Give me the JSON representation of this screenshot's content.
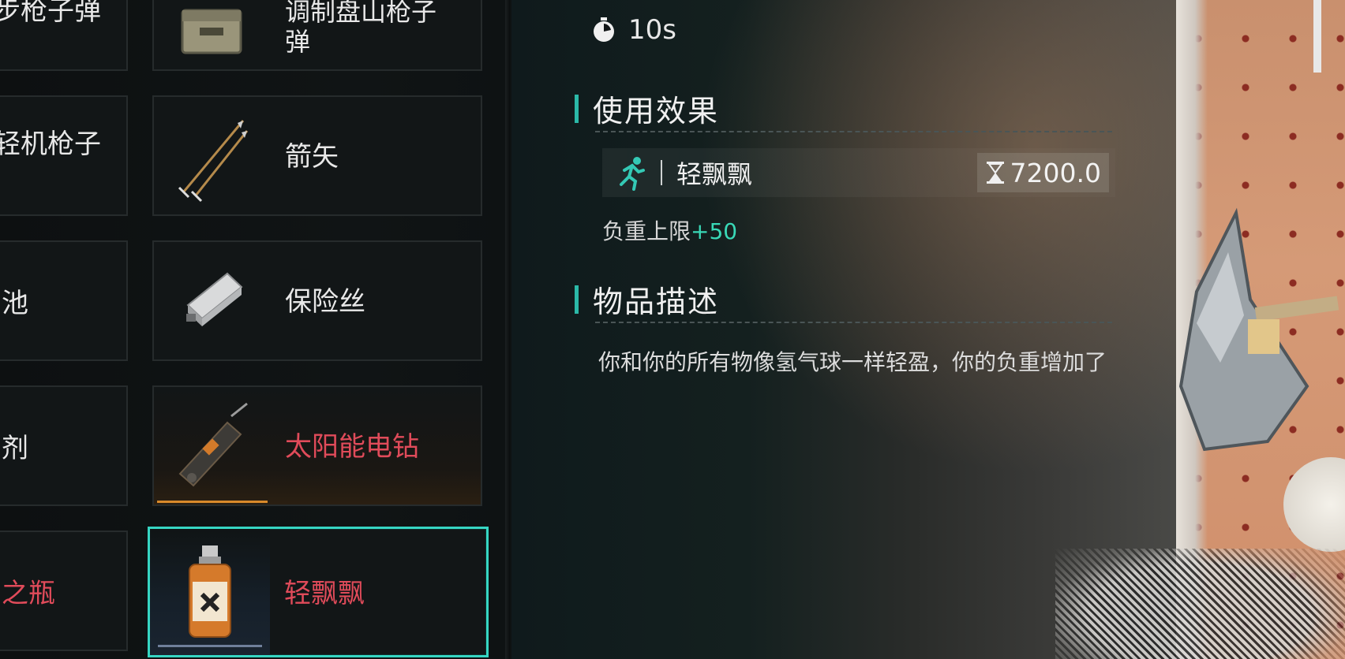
{
  "inventory": {
    "left_column": [
      {
        "label": "步枪子弹",
        "red": false
      },
      {
        "label": "轻机枪子",
        "red": false
      },
      {
        "label": "池",
        "red": false
      },
      {
        "label": "剂",
        "red": false
      },
      {
        "label": "之瓶",
        "red": true
      }
    ],
    "right_column": [
      {
        "label": "调制盘山枪子\n弹",
        "red": false,
        "icon": "ammo-box-icon"
      },
      {
        "label": "箭矢",
        "red": false,
        "icon": "arrows-icon"
      },
      {
        "label": "保险丝",
        "red": false,
        "icon": "fuse-icon"
      },
      {
        "label": "太阳能电钻",
        "red": true,
        "icon": "solar-drill-icon"
      },
      {
        "label": "轻飘飘",
        "red": true,
        "icon": "potion-bottle-icon"
      }
    ]
  },
  "detail": {
    "timer": "10s",
    "effect_section_title": "使用效果",
    "effect": {
      "icon": "running-person-icon",
      "name": "轻飘飘",
      "duration": "7200.0",
      "duration_icon": "hourglass-icon"
    },
    "stat": {
      "label": "负重上限",
      "bonus": "+50"
    },
    "description_section_title": "物品描述",
    "description": "你和你的所有物像氢气球一样轻盈，你的负重增加了"
  },
  "colors": {
    "accent_teal": "#36d6c3",
    "rare_red": "#e04b5a",
    "bonus_green": "#39d9b7",
    "orange_rarity": "#d98a2a"
  }
}
